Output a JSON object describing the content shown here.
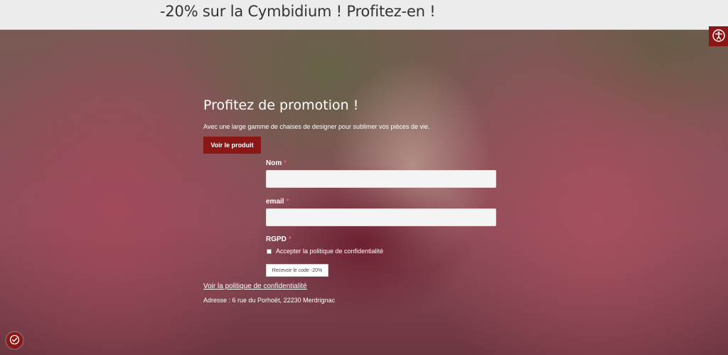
{
  "banner": {
    "text": "-20% sur la Cymbidium ! Profitez-en !"
  },
  "promo": {
    "title": "Profitez de promotion !",
    "description": "Avec une large gamme de chaises de designer pour sublimer vos pièces de vie.",
    "cta_label": "Voir le produit"
  },
  "form": {
    "name_label": "Nom",
    "email_label": "email",
    "rgpd_label": "RGPD",
    "required_mark": "*",
    "name_value": "",
    "email_value": "",
    "consent_label": "Accepter la politique de confidentialité",
    "consent_checked": false,
    "submit_label": "Recevoir le code -20%"
  },
  "footer": {
    "privacy_link": "Voir la politique de confidentialité",
    "address": "Adresse : 6 rue du Porhoët, 22230 Merdrignac"
  },
  "icons": {
    "accessibility": "accessibility-icon",
    "cookie": "cookie-consent-icon"
  },
  "colors": {
    "accent": "#8b1616",
    "banner_bg": "#ececec",
    "banner_text": "#333333",
    "input_bg": "#f4f4f4"
  }
}
